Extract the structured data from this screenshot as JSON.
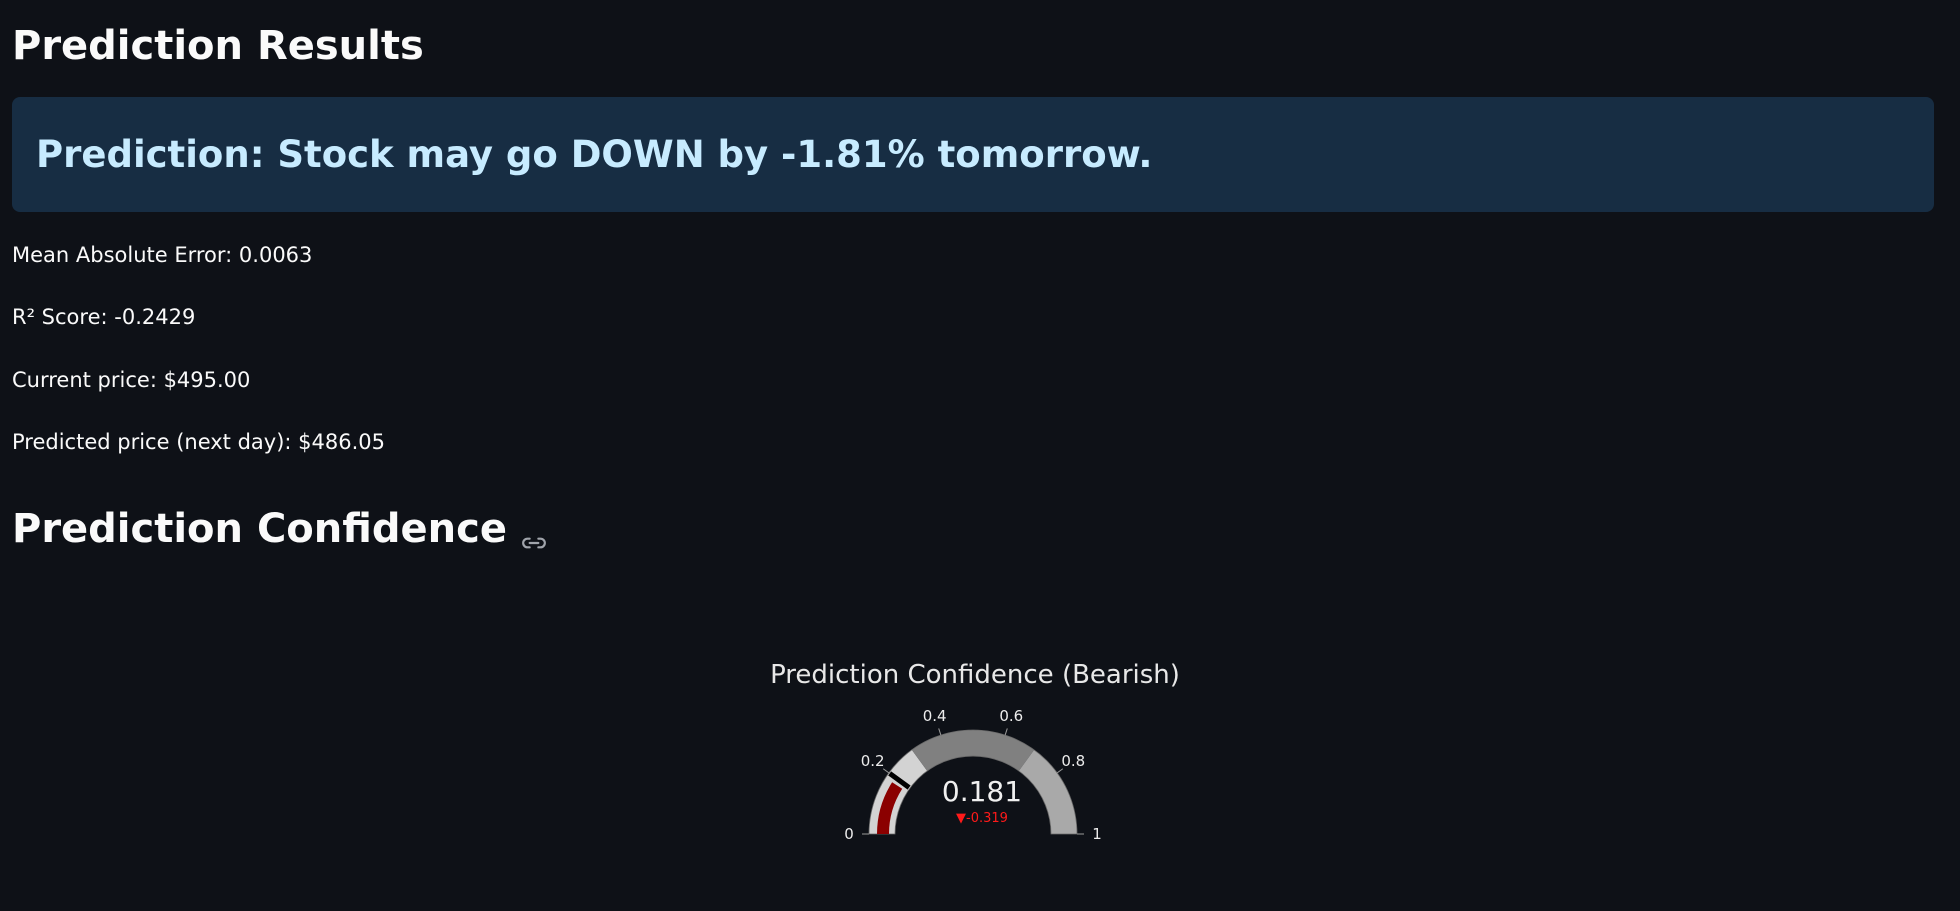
{
  "results": {
    "title": "Prediction Results",
    "banner": "Prediction: Stock may go DOWN by -1.81% tomorrow."
  },
  "metrics": {
    "mae": "Mean Absolute Error: 0.0063",
    "r2": "R² Score: -0.2429",
    "current_price": "Current price: $495.00",
    "predicted_price": "Predicted price (next day): $486.05"
  },
  "confidence": {
    "title": "Prediction Confidence",
    "link_icon": "link-icon"
  },
  "chart_data": {
    "type": "gauge",
    "title": "Prediction Confidence (Bearish)",
    "value": 0.181,
    "value_label": "0.181",
    "delta": -0.319,
    "delta_label": "▼-0.319",
    "range": [
      0,
      1
    ],
    "ticks": [
      0,
      0.2,
      0.4,
      0.6,
      0.8,
      1
    ],
    "tick_labels": [
      "0",
      "0.2",
      "0.4",
      "0.6",
      "0.8",
      "1"
    ],
    "steps": [
      {
        "range": [
          0,
          0.3
        ],
        "color": "#d3d3d3"
      },
      {
        "range": [
          0.3,
          0.7
        ],
        "color": "#808080"
      },
      {
        "range": [
          0.7,
          1
        ],
        "color": "#a9a9a9"
      }
    ],
    "bar_color": "#8b0000",
    "threshold": 0.2,
    "threshold_color": "#000000",
    "delta_color": "#ff1a1a"
  }
}
